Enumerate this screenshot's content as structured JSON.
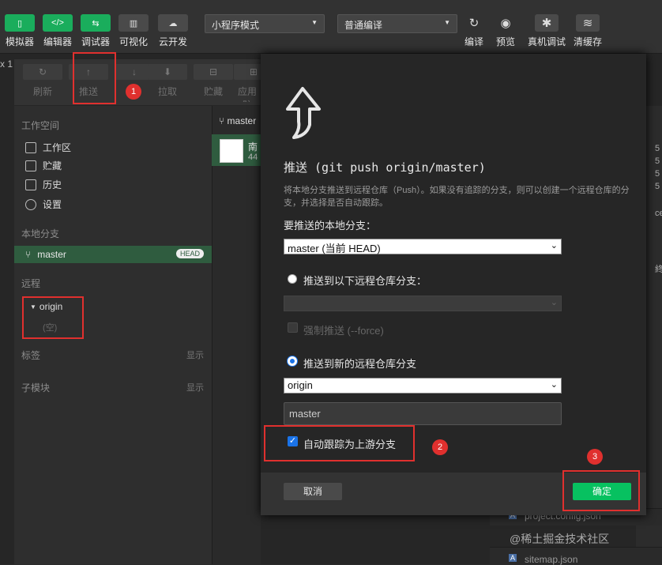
{
  "toolbar": {
    "simulator": "模拟器",
    "editor": "编辑器",
    "debugger": "调试器",
    "visualize": "可视化",
    "cloud": "云开发",
    "mode_select": "小程序模式",
    "compile_select": "普通编译",
    "compile": "编译",
    "preview": "预览",
    "real_debug": "真机调试",
    "clear_cache": "清缓存"
  },
  "git_toolbar": {
    "refresh": "刷新",
    "push": "推送",
    "pull": "拉取",
    "stash": "贮藏",
    "apply": "应用贮"
  },
  "sidebar": {
    "workspace_header": "工作空间",
    "items": [
      "工作区",
      "贮藏",
      "历史",
      "设置"
    ],
    "local_header": "本地分支",
    "branch": "master",
    "head_badge": "HEAD",
    "remote_header": "远程",
    "remote": "origin",
    "remote_empty": "(空)",
    "tags_header": "标签",
    "submodule_header": "子模块",
    "show": "显示"
  },
  "commit_panel": {
    "branch": "master",
    "commit_line1": "南",
    "commit_line2": "44"
  },
  "dialog": {
    "title": "推送 (git push origin/master)",
    "description": "将本地分支推送到远程仓库（Push）。如果没有追踪的分支，则可以创建一个远程仓库的分支，并选择是否自动跟踪。",
    "local_branch_label": "要推送的本地分支：",
    "local_branch_value": "master (当前 HEAD)",
    "option_existing": "推送到以下远程仓库分支：",
    "force_push": "强制推送 (--force)",
    "option_new": "推送到新的远程仓库分支",
    "remote_value": "origin",
    "new_branch_value": "master",
    "auto_track": "自动跟踪为上游分支",
    "cancel": "取消",
    "confirm": "确定"
  },
  "markers": [
    "1",
    "2",
    "3"
  ],
  "right_edge": [
    "5",
    "5",
    "5",
    "5",
    "ce",
    "終"
  ],
  "files": [
    "project.config.json",
    "sitemap.json"
  ],
  "watermark": "@稀土掘金技术社区",
  "tab_close": "x 1"
}
